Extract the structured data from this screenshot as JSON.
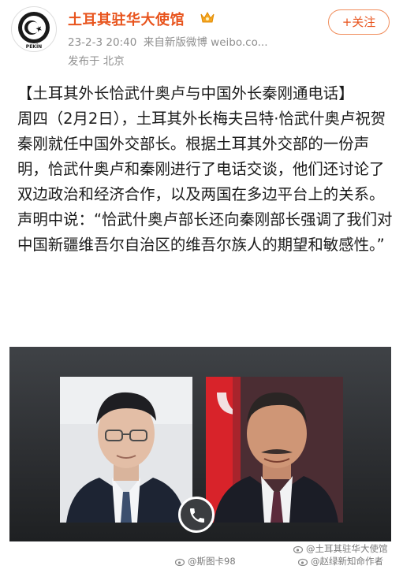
{
  "account": {
    "name": "土耳其驻华大使馆",
    "timestamp": "23-2-3 20:40",
    "source": "来自新版微博 weibo.co...",
    "location": "发布于 北京",
    "avatar_text": "PEKİN"
  },
  "follow_button": {
    "label": "+关注"
  },
  "post": {
    "title": "【土耳其外长恰武什奥卢与中国外长秦刚通电话】",
    "body": "周四（2月2日），土耳其外长梅夫吕特·恰武什奥卢祝贺秦刚就任中国外交部长。根据土耳其外交部的一份声明，恰武什奥卢和秦刚进行了电话交谈，他们还讨论了双边政治和经济合作，以及两国在多边平台上的关系。声明中说：“恰武什奥卢部长还向秦刚部长强调了我们对中国新疆维吾尔自治区的维吾尔族人的期望和敏感性。”"
  },
  "watermarks": {
    "wm1": "@斯图卡98",
    "wm2": "@土耳其驻华大使馆",
    "wm3": "@赵绿新知命作者"
  },
  "colors": {
    "accent": "#e8541d",
    "meta_gray": "#8f8f8f",
    "turkish_red": "#d8232a"
  }
}
